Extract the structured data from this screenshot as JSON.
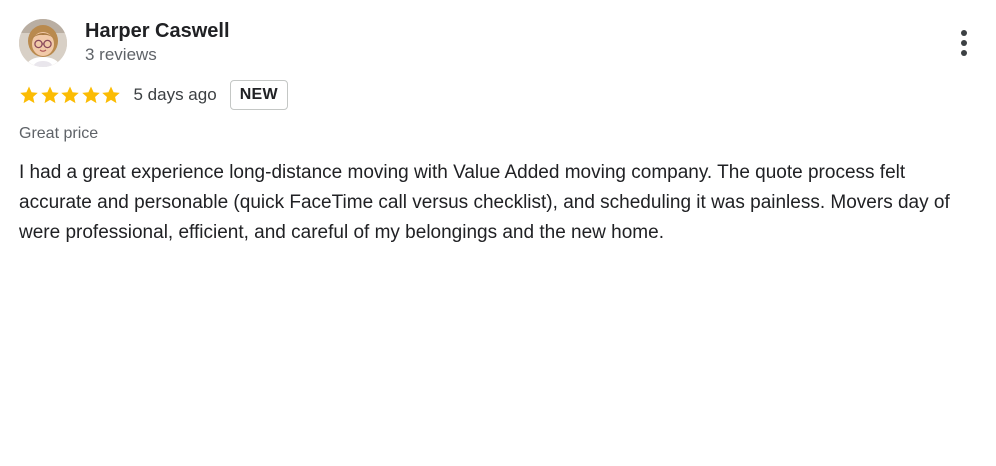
{
  "reviewer": {
    "name": "Harper Caswell",
    "meta": "3 reviews",
    "avatar_icon": "profile-photo"
  },
  "rating": {
    "stars": 5,
    "max_stars": 5,
    "star_color": "#fbbc04",
    "time_ago": "5 days ago",
    "badge": "NEW"
  },
  "review": {
    "subject": "Great price",
    "text": "I had a great experience long-distance moving with Value Added moving company. The quote process felt accurate and personable (quick FaceTime call versus checklist), and scheduling it was painless. Movers day of were professional, efficient, and careful of my belongings and the new home."
  },
  "menu": {
    "icon": "more-vert-icon"
  }
}
